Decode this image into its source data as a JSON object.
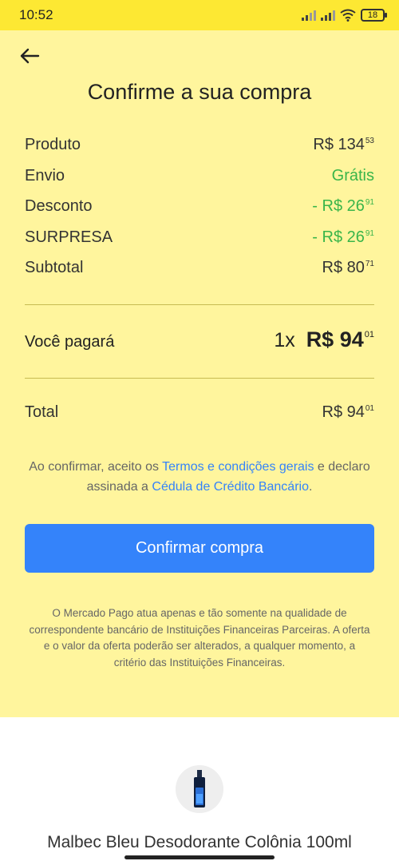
{
  "status_bar": {
    "time": "10:52",
    "battery": "18"
  },
  "header": {
    "back_icon": "arrow-left-icon",
    "title": "Confirme a sua compra"
  },
  "summary": [
    {
      "label": "Produto",
      "amount": "R$ 134",
      "cents": "53",
      "color": "#333333"
    },
    {
      "label": "Envio",
      "amount": "Grátis",
      "cents": "",
      "color": "#39b54a"
    },
    {
      "label": "Desconto",
      "amount": "- R$ 26",
      "cents": "91",
      "color": "#39b54a"
    },
    {
      "label": "SURPRESA",
      "amount": "- R$ 26",
      "cents": "91",
      "color": "#39b54a"
    },
    {
      "label": "Subtotal",
      "amount": "R$ 80",
      "cents": "71",
      "color": "#333333"
    }
  ],
  "payment": {
    "label": "Você pagará",
    "installments": "1x",
    "amount": "R$ 94",
    "cents": "01"
  },
  "total": {
    "label": "Total",
    "amount": "R$ 94",
    "cents": "01"
  },
  "terms": {
    "prefix": "Ao confirmar, aceito os ",
    "link1": "Termos e condições gerais",
    "middle": " e declaro assinada a ",
    "link2": "Cédula de Crédito Bancário",
    "suffix": "."
  },
  "confirm_button": {
    "label": "Confirmar compra"
  },
  "disclaimer": "O Mercado Pago atua apenas e tão somente na qualidade de correspondente bancário de Instituições Financeiras Parceiras. A oferta e o valor da oferta poderão ser alterados, a qualquer momento, a critério das Instituições Financeiras.",
  "product": {
    "name": "Malbec Bleu Desodorante Colônia 100ml",
    "image_icon": "perfume-bottle-icon"
  },
  "colors": {
    "accent": "#3483fa",
    "background": "#fff59d",
    "status_bar": "#fde833",
    "positive": "#39b54a"
  }
}
